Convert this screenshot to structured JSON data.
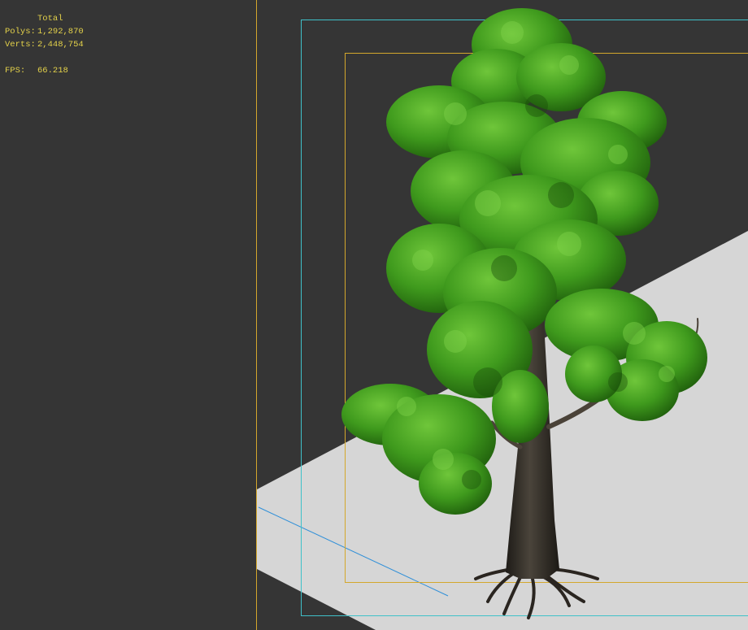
{
  "stats": {
    "header": "Total",
    "polys_label": "Polys:",
    "polys_value": "1,292,870",
    "verts_label": "Verts:",
    "verts_value": "2,448,754",
    "fps_label": "FPS:",
    "fps_value": "66.218"
  },
  "colors": {
    "background": "#353535",
    "stats_text": "#e3d14a",
    "ground_plane": "#d6d6d6",
    "safe_frame_outer": "#3fc1c9",
    "safe_frame_inner": "#d4a72c",
    "viewport_divider": "#d4a72c",
    "foliage": "#3e9a1c",
    "trunk": "#2e2a24"
  }
}
